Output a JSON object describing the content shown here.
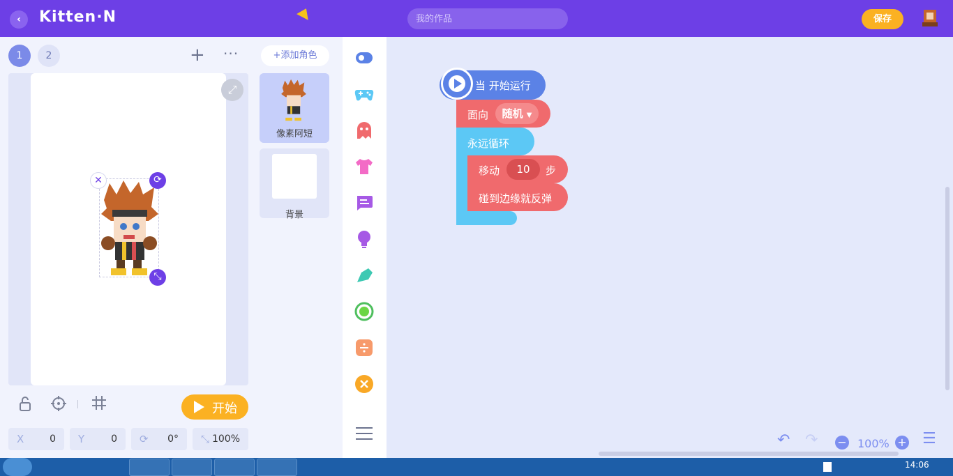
{
  "app": {
    "logo": "Kitten·N",
    "title_placeholder": "我的作品",
    "save_label": "保存"
  },
  "scenes": {
    "tabs": [
      "1",
      "2"
    ],
    "add_icon": "plus-icon",
    "more_icon": "more-icon"
  },
  "stage": {
    "start_label": "开始",
    "x_label": "X",
    "x_value": "0",
    "y_label": "Y",
    "y_value": "0",
    "rotation": "0°",
    "scale": "100%"
  },
  "sprites": {
    "add_label": "+添加角色",
    "items": [
      {
        "name": "像素阿短"
      },
      {
        "name": "背景"
      }
    ]
  },
  "categories": [
    "events",
    "controls",
    "actions",
    "looks",
    "dialogue",
    "sound",
    "pen",
    "sensing",
    "operators",
    "variables"
  ],
  "blocks": {
    "hat": "当 开始运行",
    "face_label": "面向",
    "face_value": "随机",
    "loop_label": "永远循环",
    "move_label": "移动",
    "move_value": "10",
    "move_unit": "步",
    "bounce_label": "碰到边缘就反弹"
  },
  "workspace": {
    "zoom": "100%"
  },
  "taskbar": {
    "time": "14:06"
  },
  "colors": {
    "topbar": "#6d3fe6",
    "accent": "#fbb122",
    "event": "#5b82e6",
    "action": "#f06a6d",
    "control": "#5cc8f5"
  }
}
